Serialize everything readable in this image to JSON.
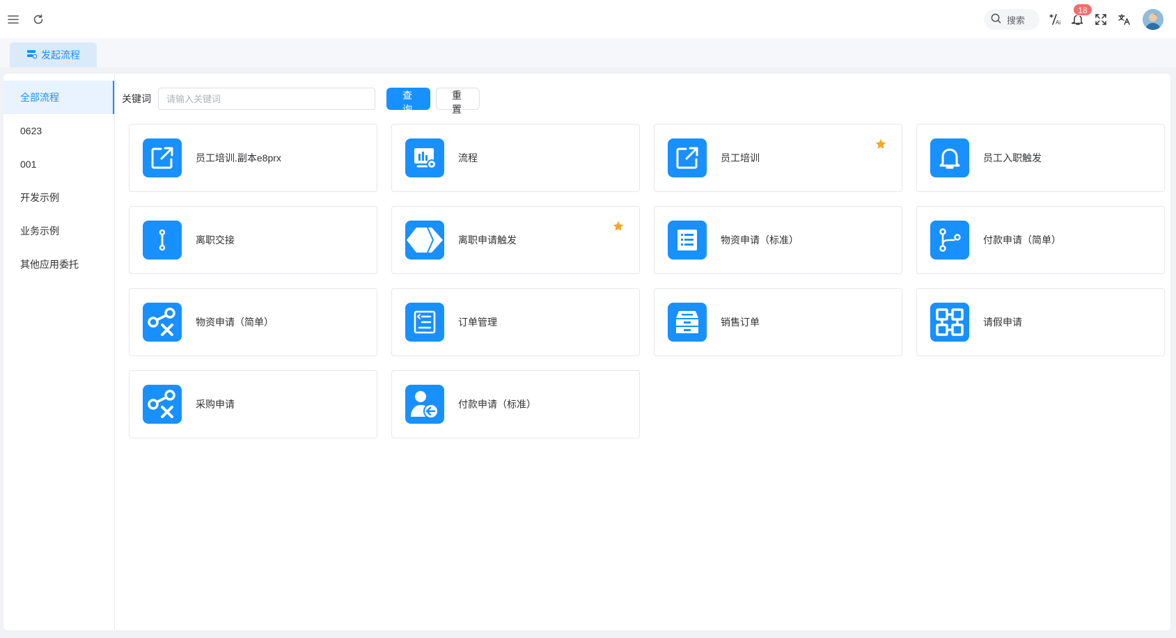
{
  "header": {
    "search_placeholder": "搜索",
    "notification_count": "18",
    "icons": [
      "menu-icon",
      "refresh-icon",
      "search-icon",
      "ai-icon",
      "bell-icon",
      "fullscreen-icon",
      "translate-icon"
    ]
  },
  "tabs": [
    {
      "label": "发起流程",
      "icon": "workflow-icon"
    }
  ],
  "sidebar": {
    "items": [
      {
        "label": "全部流程",
        "active": true
      },
      {
        "label": "0623"
      },
      {
        "label": "001"
      },
      {
        "label": "开发示例"
      },
      {
        "label": "业务示例"
      },
      {
        "label": "其他应用委托"
      }
    ]
  },
  "filter": {
    "keyword_label": "关键词",
    "keyword_placeholder": "请输入关键词",
    "keyword_value": "",
    "query_label": "查询",
    "reset_label": "重置"
  },
  "colors": {
    "primary": "#1890ff",
    "star": "#f5a623",
    "badge": "#f56c6c"
  },
  "processes": [
    {
      "name": "员工培训.副本e8prx",
      "icon": "external-link-icon",
      "starred": false
    },
    {
      "name": "流程",
      "icon": "dashboard-settings-icon",
      "starred": false
    },
    {
      "name": "员工培训",
      "icon": "external-link-icon",
      "starred": true
    },
    {
      "name": "员工入职触发",
      "icon": "bell-icon",
      "starred": false
    },
    {
      "name": "离职交接",
      "icon": "link-vertical-icon",
      "starred": false
    },
    {
      "name": "离职申请触发",
      "icon": "diamond-tag-icon",
      "starred": true
    },
    {
      "name": "物资申请（标准）",
      "icon": "list-document-icon",
      "starred": false
    },
    {
      "name": "付款申请（简单）",
      "icon": "branch-icon",
      "starred": false
    },
    {
      "name": "物资申请（简单）",
      "icon": "node-share-icon",
      "starred": false
    },
    {
      "name": "订单管理",
      "icon": "order-list-icon",
      "starred": false
    },
    {
      "name": "销售订单",
      "icon": "archive-box-icon",
      "starred": false
    },
    {
      "name": "请假申请",
      "icon": "grid-blocks-icon",
      "starred": false
    },
    {
      "name": "采购申请",
      "icon": "node-share-icon",
      "starred": false
    },
    {
      "name": "付款申请（标准）",
      "icon": "user-return-icon",
      "starred": false
    }
  ]
}
